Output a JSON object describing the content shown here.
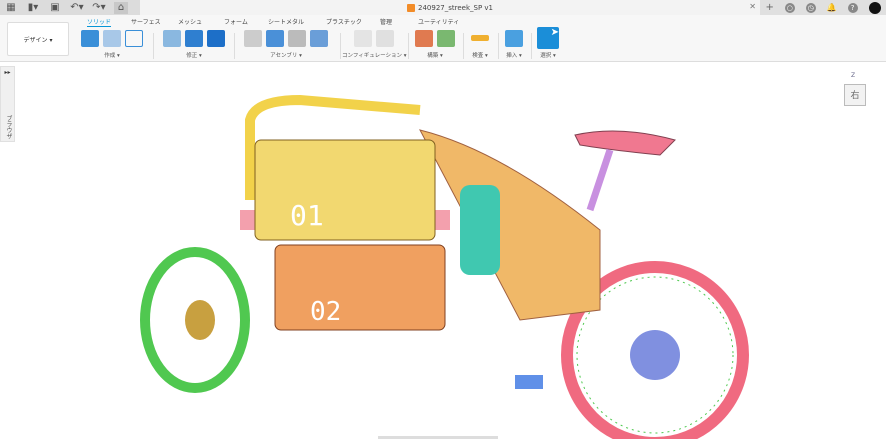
{
  "window": {
    "document_title": "240927_streek_SP v1"
  },
  "topbar": {
    "icons": [
      "grid-icon",
      "file-icon",
      "save-icon",
      "undo-icon",
      "redo-icon",
      "home-icon"
    ],
    "right_icons": [
      "add-tab-icon",
      "extensions-icon",
      "job-status-icon",
      "notifications-icon",
      "help-icon",
      "user-avatar"
    ]
  },
  "toolbar": {
    "workspace": "デザイン ▾",
    "tabs": [
      {
        "label": "ソリッド",
        "active": true
      },
      {
        "label": "サーフェス"
      },
      {
        "label": "メッシュ"
      },
      {
        "label": "フォーム"
      },
      {
        "label": "シートメタル"
      },
      {
        "label": "プラスチック"
      },
      {
        "label": "管理"
      },
      {
        "label": "ユーティリティ"
      }
    ],
    "groups": [
      {
        "label": "作成 ▾"
      },
      {
        "label": "修正 ▾"
      },
      {
        "label": "アセンブリ ▾"
      },
      {
        "label": "コンフィギュレーション ▾"
      },
      {
        "label": "構築 ▾"
      },
      {
        "label": "検査 ▾"
      },
      {
        "label": "挿入 ▾"
      },
      {
        "label": "選択 ▾"
      }
    ]
  },
  "browser": {
    "label": "ブラウザ",
    "expand": "▸▸"
  },
  "viewcube": {
    "face": "右",
    "axis": "Z"
  },
  "model": {
    "box_labels": [
      "01",
      "02"
    ]
  },
  "colors": {
    "accent": "#0696d7",
    "yellow": "#f2d24a",
    "orange": "#f0a060",
    "pink": "#f06a80",
    "green": "#50c850",
    "teal": "#40c8b0"
  }
}
